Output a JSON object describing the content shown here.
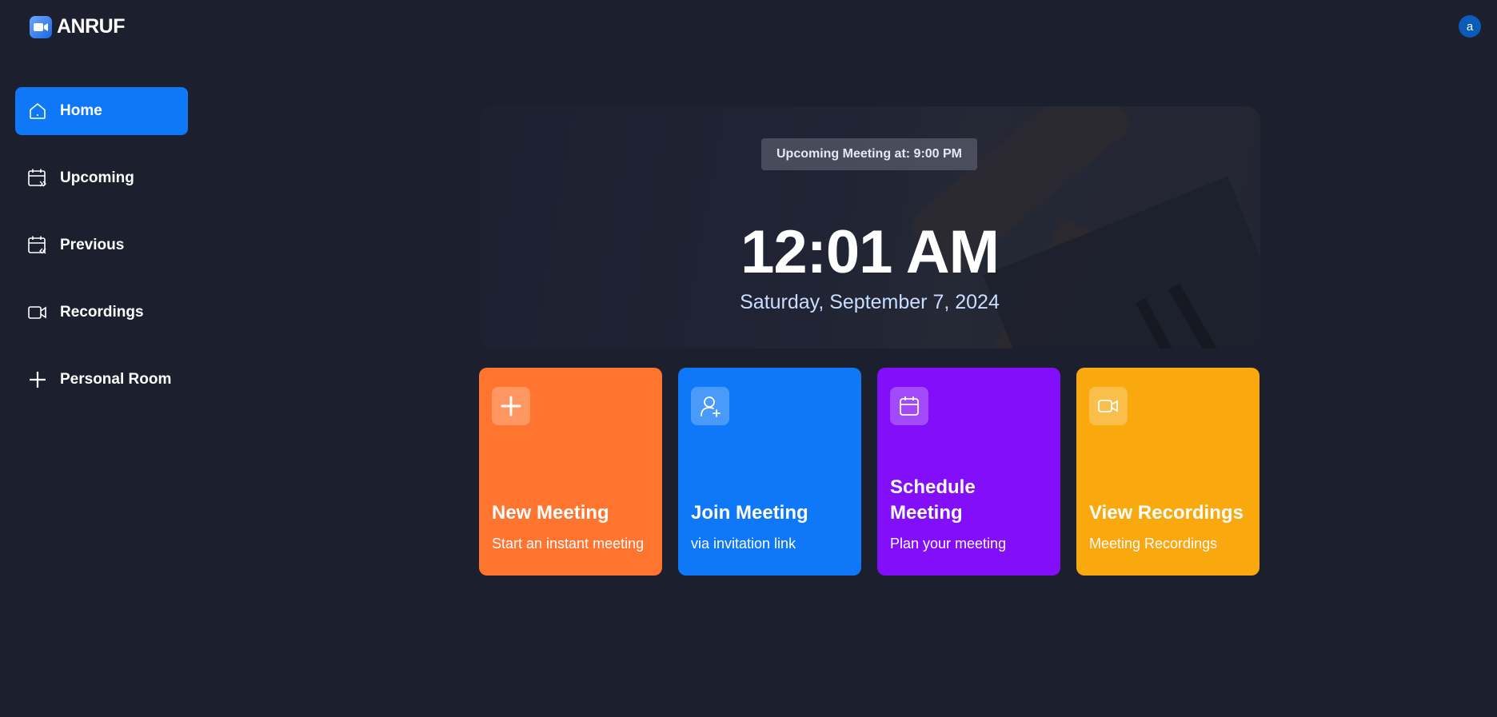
{
  "brand": {
    "name": "ANRUF"
  },
  "user": {
    "avatar_initial": "a"
  },
  "sidebar": {
    "items": [
      {
        "label": "Home",
        "icon": "home-icon",
        "active": true
      },
      {
        "label": "Upcoming",
        "icon": "calendar-forward-icon"
      },
      {
        "label": "Previous",
        "icon": "calendar-back-icon"
      },
      {
        "label": "Recordings",
        "icon": "video-icon"
      },
      {
        "label": "Personal Room",
        "icon": "plus-icon"
      }
    ]
  },
  "hero": {
    "upcoming": "Upcoming Meeting at: 9:00 PM",
    "time": "12:01 AM",
    "date": "Saturday, September 7, 2024"
  },
  "cards": [
    {
      "title": "New Meeting",
      "desc": "Start an instant meeting",
      "icon": "plus-icon",
      "color": "#ff742e"
    },
    {
      "title": "Join Meeting",
      "desc": "via invitation link",
      "icon": "user-plus-icon",
      "color": "#0e78f9"
    },
    {
      "title": "Schedule Meeting",
      "desc": "Plan your meeting",
      "icon": "calendar-icon",
      "color": "#830ef9"
    },
    {
      "title": "View Recordings",
      "desc": "Meeting Recordings",
      "icon": "video-icon",
      "color": "#f9a90e"
    }
  ],
  "colors": {
    "background": "#1c1f2e",
    "accent": "#0e78f9"
  }
}
